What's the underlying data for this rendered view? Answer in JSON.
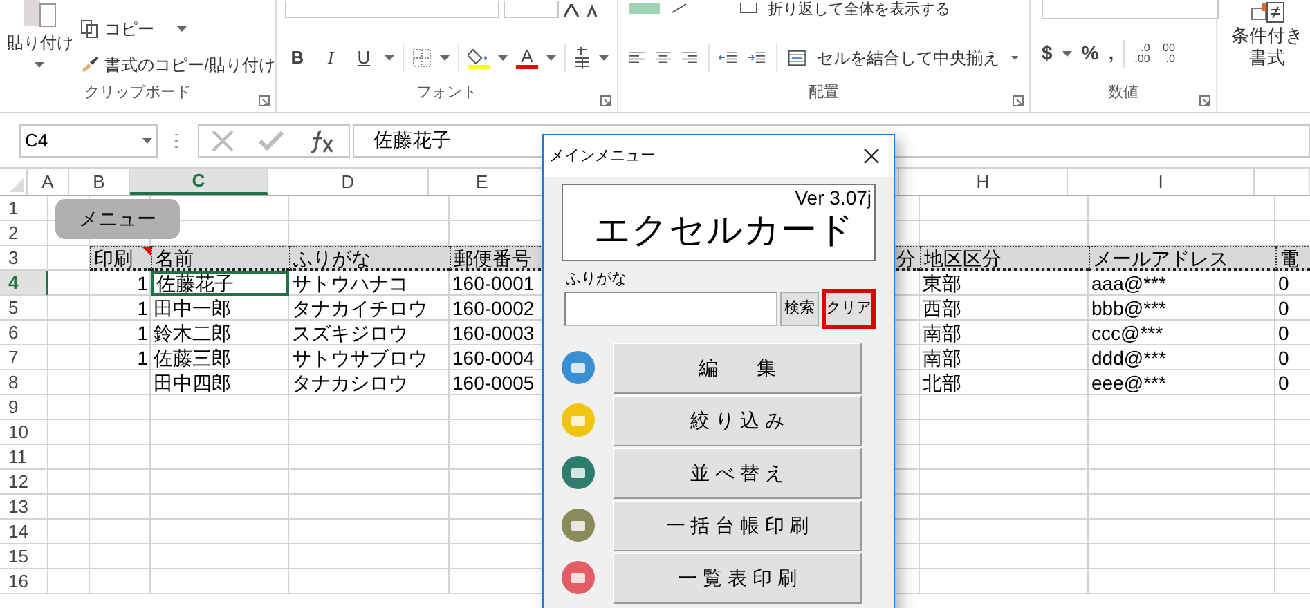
{
  "ribbon": {
    "clipboard": {
      "paste": "貼り付け",
      "copy": "コピー",
      "format_painter": "書式のコピー/貼り付け",
      "label": "クリップボード"
    },
    "font": {
      "buttons": [
        "B",
        "I",
        "U"
      ],
      "font_color_glyph": "A",
      "label": "フォント"
    },
    "alignment": {
      "wrap_text": "折り返して全体を表示する",
      "merge": "セルを結合して中央揃え",
      "label": "配置"
    },
    "number": {
      "buttons": [
        "$",
        "%",
        ","
      ],
      "decimal_icons": [
        {
          "top": ".0",
          "bottom": ".00"
        },
        {
          "top": ".00",
          "bottom": ".0"
        }
      ],
      "label": "数値"
    },
    "styles": {
      "conditional_line1": "条件付き",
      "conditional_line2": "書式"
    }
  },
  "formula_bar": {
    "name_box": "C4",
    "formula": "佐藤花子"
  },
  "sheet": {
    "columns": [
      {
        "label": "A",
        "selected": false
      },
      {
        "label": "B",
        "selected": false
      },
      {
        "label": "C",
        "selected": true
      },
      {
        "label": "D",
        "selected": false
      },
      {
        "label": "E",
        "selected": false
      },
      {},
      {
        "label": "H",
        "selected": false
      },
      {
        "label": "I",
        "selected": false
      },
      {}
    ],
    "shape_button": "メニュー",
    "rows": [
      {
        "number": "1",
        "selected": false,
        "kind": "blank"
      },
      {
        "number": "2",
        "selected": false,
        "kind": "blank"
      },
      {
        "number": "3",
        "selected": false,
        "kind": "header",
        "cells": [
          null,
          "印刷",
          "名前",
          "ふりがな",
          "郵便番号",
          "分",
          "地区区分",
          "メールアドレス",
          "電"
        ]
      },
      {
        "number": "4",
        "selected": true,
        "kind": "data",
        "cells": [
          null,
          "1",
          "佐藤花子",
          "サトウハナコ",
          "160-0001",
          null,
          "東部",
          "aaa@***",
          "0"
        ]
      },
      {
        "number": "5",
        "selected": false,
        "kind": "data",
        "cells": [
          null,
          "1",
          "田中一郎",
          "タナカイチロウ",
          "160-0002",
          null,
          "西部",
          "bbb@***",
          "0"
        ]
      },
      {
        "number": "6",
        "selected": false,
        "kind": "data",
        "cells": [
          null,
          "1",
          "鈴木二郎",
          "スズキジロウ",
          "160-0003",
          null,
          "南部",
          "ccc@***",
          "0"
        ]
      },
      {
        "number": "7",
        "selected": false,
        "kind": "data",
        "cells": [
          null,
          "1",
          "佐藤三郎",
          "サトウサブロウ",
          "160-0004",
          null,
          "南部",
          "ddd@***",
          "0"
        ]
      },
      {
        "number": "8",
        "selected": false,
        "kind": "data",
        "cells": [
          null,
          null,
          "田中四郎",
          "タナカシロウ",
          "160-0005",
          null,
          "北部",
          "eee@***",
          "0"
        ]
      },
      {
        "number": "9",
        "selected": false,
        "kind": "blank"
      },
      {
        "number": "10",
        "selected": false,
        "kind": "blank"
      },
      {
        "number": "11",
        "selected": false,
        "kind": "blank"
      },
      {
        "number": "12",
        "selected": false,
        "kind": "blank"
      },
      {
        "number": "13",
        "selected": false,
        "kind": "blank"
      },
      {
        "number": "14",
        "selected": false,
        "kind": "blank"
      },
      {
        "number": "15",
        "selected": false,
        "kind": "blank"
      },
      {
        "number": "16",
        "selected": false,
        "kind": "blank"
      }
    ]
  },
  "dialog": {
    "title": "メインメニュー",
    "version": "Ver 3.07j",
    "app_name": "エクセルカード",
    "search_label": "ふりがな",
    "search_button": "検索",
    "clear_button": {
      "label": "クリア",
      "highlighted": true
    },
    "menu": [
      {
        "label": "編　　集",
        "color": "#3a8fd3"
      },
      {
        "label": "絞 り 込 み",
        "color": "#f1c40f"
      },
      {
        "label": "並 べ 替 え",
        "color": "#2e7d6c"
      },
      {
        "label": "一 括 台 帳 印 刷",
        "color": "#8b8a5a"
      },
      {
        "label": "一 覧 表 印 刷",
        "color": "#e35d66"
      }
    ]
  }
}
